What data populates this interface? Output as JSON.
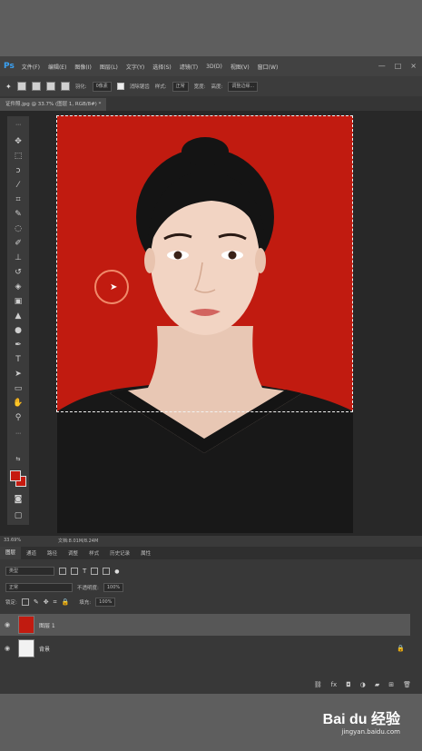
{
  "app": {
    "logo": "Ps"
  },
  "menu": [
    "文件(F)",
    "编辑(E)",
    "图像(I)",
    "图层(L)",
    "文字(Y)",
    "选择(S)",
    "滤镜(T)",
    "3D(D)",
    "视图(V)",
    "窗口(W)"
  ],
  "window_controls": [
    "—",
    "□",
    "×"
  ],
  "options": {
    "feather_label": "羽化:",
    "feather_value": "0像素",
    "style_label": "样式:",
    "style_value": "正常",
    "width_label": "宽度:",
    "height_label": "高度:",
    "anti_alias_label": "消除锯齿",
    "refine_label": "调整边缘..."
  },
  "document": {
    "tab_label": "证件照.jpg @ 33.7% (图层 1, RGB/8#) *",
    "zoom": "33.69%",
    "doc_info": "文档:8.01M/8.24M"
  },
  "colors": {
    "foreground": "#c61a0f",
    "background": "#c61a0f",
    "canvas_bg": "#c11b10"
  },
  "panels": {
    "tabs": [
      "图层",
      "通道",
      "路径",
      "调整",
      "样式",
      "历史记录",
      "属性"
    ],
    "kind_label": "类型",
    "blend_mode": "正常",
    "opacity_label": "不透明度:",
    "opacity_value": "100%",
    "lock_label": "锁定:",
    "fill_label": "填充:",
    "fill_value": "100%"
  },
  "layers": [
    {
      "name": "图层 1",
      "selected": true
    },
    {
      "name": "背景",
      "selected": false,
      "locked": true
    }
  ],
  "watermark": {
    "logo": "Bai du 经验",
    "url": "jingyan.baidu.com"
  }
}
